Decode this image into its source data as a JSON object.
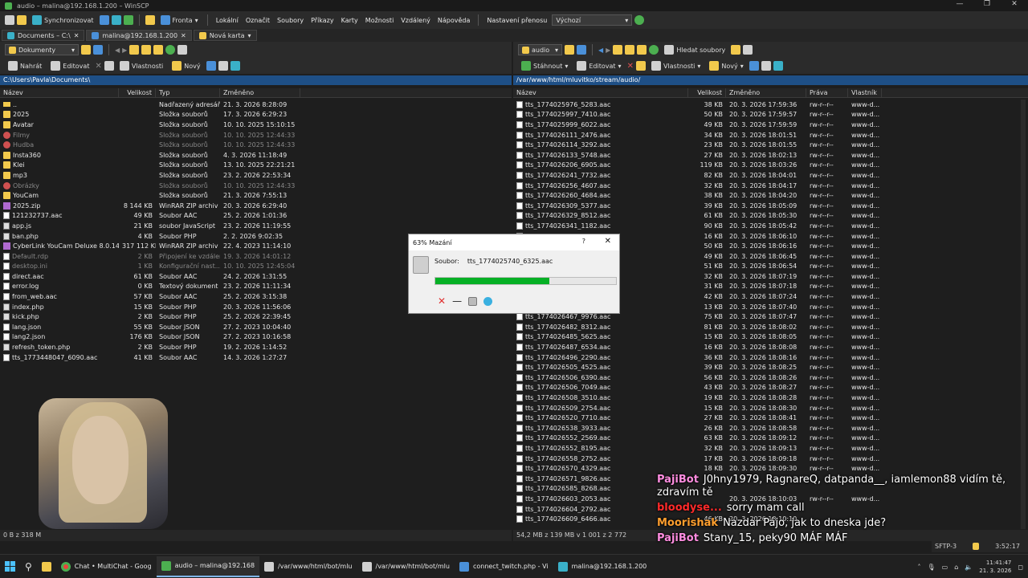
{
  "window": {
    "title": "audio – malina@192.168.1.200 – WinSCP",
    "controls": [
      "—",
      "❐",
      "✕"
    ]
  },
  "menubar": {
    "sync": "Synchronizovat",
    "queue": "Fronta",
    "menus": [
      "Lokální",
      "Označit",
      "Soubory",
      "Příkazy",
      "Karty",
      "Možnosti",
      "Vzdálený",
      "Nápověda"
    ],
    "transfer_label": "Nastavení přenosu",
    "transfer_value": "Výchozí"
  },
  "tabs": [
    {
      "label": "Documents – C:\\"
    },
    {
      "label": "malina@192.168.1.200"
    },
    {
      "label": "Nová karta"
    }
  ],
  "left": {
    "location": "Dokumenty",
    "actions": {
      "upload": "Nahrát",
      "edit": "Editovat",
      "props": "Vlastnosti",
      "new": "Nový"
    },
    "path": "C:\\Users\\Pavla\\Documents\\",
    "columns": {
      "name": "Název",
      "size": "Velikost",
      "type": "Typ",
      "changed": "Změněno"
    },
    "rows": [
      {
        "name": "..",
        "size": "",
        "type": "Nadřazený adresář",
        "changed": "21. 3. 2026 8:28:09",
        "icon": "up",
        "dim": false
      },
      {
        "name": "2025",
        "size": "",
        "type": "Složka souborů",
        "changed": "17. 3. 2026 6:29:23",
        "icon": "dir",
        "dim": false
      },
      {
        "name": "Avatar",
        "size": "",
        "type": "Složka souborů",
        "changed": "10. 10. 2025 15:10:15",
        "icon": "dir",
        "dim": false
      },
      {
        "name": "Filmy",
        "size": "",
        "type": "Složka souborů",
        "changed": "10. 10. 2025 12:44:33",
        "icon": "red",
        "dim": true
      },
      {
        "name": "Hudba",
        "size": "",
        "type": "Složka souborů",
        "changed": "10. 10. 2025 12:44:33",
        "icon": "red",
        "dim": true
      },
      {
        "name": "Insta360",
        "size": "",
        "type": "Složka souborů",
        "changed": "4. 3. 2026 11:18:49",
        "icon": "dir",
        "dim": false
      },
      {
        "name": "Klei",
        "size": "",
        "type": "Složka souborů",
        "changed": "13. 10. 2025 22:21:21",
        "icon": "dir",
        "dim": false
      },
      {
        "name": "mp3",
        "size": "",
        "type": "Složka souborů",
        "changed": "23. 2. 2026 22:53:34",
        "icon": "dir",
        "dim": false
      },
      {
        "name": "Obrázky",
        "size": "",
        "type": "Složka souborů",
        "changed": "10. 10. 2025 12:44:33",
        "icon": "red",
        "dim": true
      },
      {
        "name": "YouCam",
        "size": "",
        "type": "Složka souborů",
        "changed": "21. 3. 2026 7:55:13",
        "icon": "dir",
        "dim": false
      },
      {
        "name": "2025.zip",
        "size": "8 144 KB",
        "type": "WinRAR ZIP archiv",
        "changed": "20. 3. 2026 6:29:40",
        "icon": "zip",
        "dim": false
      },
      {
        "name": "121232737.aac",
        "size": "49 KB",
        "type": "Soubor AAC",
        "changed": "25. 2. 2026 1:01:36",
        "icon": "file",
        "dim": false
      },
      {
        "name": "app.js",
        "size": "21 KB",
        "type": "soubor JavaScript",
        "changed": "23. 2. 2026 11:19:55",
        "icon": "php",
        "dim": false
      },
      {
        "name": "ban.php",
        "size": "4 KB",
        "type": "Soubor PHP",
        "changed": "2. 2. 2026 9:02:35",
        "icon": "php",
        "dim": false
      },
      {
        "name": "CyberLink YouCam Deluxe 8.0.1411...",
        "size": "317 112 KB",
        "type": "WinRAR ZIP archiv",
        "changed": "22. 4. 2023 11:14:10",
        "icon": "zip",
        "dim": false
      },
      {
        "name": "Default.rdp",
        "size": "2 KB",
        "type": "Připojení ke vzdálené...",
        "changed": "19. 3. 2026 14:01:12",
        "icon": "file",
        "dim": true
      },
      {
        "name": "desktop.ini",
        "size": "1 KB",
        "type": "Konfigurační nast...",
        "changed": "10. 10. 2025 12:45:04",
        "icon": "file",
        "dim": true
      },
      {
        "name": "direct.aac",
        "size": "61 KB",
        "type": "Soubor AAC",
        "changed": "24. 2. 2026 1:31:55",
        "icon": "file",
        "dim": false
      },
      {
        "name": "error.log",
        "size": "0 KB",
        "type": "Textový dokument",
        "changed": "23. 2. 2026 11:11:34",
        "icon": "file",
        "dim": false
      },
      {
        "name": "from_web.aac",
        "size": "57 KB",
        "type": "Soubor AAC",
        "changed": "25. 2. 2026 3:15:38",
        "icon": "file",
        "dim": false
      },
      {
        "name": "index.php",
        "size": "15 KB",
        "type": "Soubor PHP",
        "changed": "20. 3. 2026 11:56:06",
        "icon": "php",
        "dim": false
      },
      {
        "name": "kick.php",
        "size": "2 KB",
        "type": "Soubor PHP",
        "changed": "25. 2. 2026 22:39:45",
        "icon": "php",
        "dim": false
      },
      {
        "name": "lang.json",
        "size": "55 KB",
        "type": "Soubor JSON",
        "changed": "27. 2. 2023 10:04:40",
        "icon": "file",
        "dim": false
      },
      {
        "name": "lang2.json",
        "size": "176 KB",
        "type": "Soubor JSON",
        "changed": "27. 2. 2023 10:16:58",
        "icon": "file",
        "dim": false
      },
      {
        "name": "refresh_token.php",
        "size": "2 KB",
        "type": "Soubor PHP",
        "changed": "19. 2. 2026 1:14:52",
        "icon": "php",
        "dim": false
      },
      {
        "name": "tts_1773448047_6090.aac",
        "size": "41 KB",
        "type": "Soubor AAC",
        "changed": "14. 3. 2026 1:27:27",
        "icon": "file",
        "dim": false
      }
    ],
    "status": "0 B z 318 M"
  },
  "right": {
    "location": "audio",
    "find": "Hledat soubory",
    "actions": {
      "download": "Stáhnout",
      "edit": "Editovat",
      "props": "Vlastnosti",
      "new": "Nový"
    },
    "path": "/var/www/html/mluvitko/stream/audio/",
    "columns": {
      "name": "Název",
      "size": "Velikost",
      "changed": "Změněno",
      "rights": "Práva",
      "owner": "Vlastník"
    },
    "rows": [
      {
        "name": "tts_1774025976_5283.aac",
        "size": "38 KB",
        "changed": "20. 3. 2026 17:59:36",
        "rights": "rw-r--r--",
        "owner": "www-d..."
      },
      {
        "name": "tts_1774025997_7410.aac",
        "size": "50 KB",
        "changed": "20. 3. 2026 17:59:57",
        "rights": "rw-r--r--",
        "owner": "www-d..."
      },
      {
        "name": "tts_1774025999_6022.aac",
        "size": "49 KB",
        "changed": "20. 3. 2026 17:59:59",
        "rights": "rw-r--r--",
        "owner": "www-d..."
      },
      {
        "name": "tts_1774026111_2476.aac",
        "size": "34 KB",
        "changed": "20. 3. 2026 18:01:51",
        "rights": "rw-r--r--",
        "owner": "www-d..."
      },
      {
        "name": "tts_1774026114_3292.aac",
        "size": "23 KB",
        "changed": "20. 3. 2026 18:01:55",
        "rights": "rw-r--r--",
        "owner": "www-d..."
      },
      {
        "name": "tts_1774026133_5748.aac",
        "size": "27 KB",
        "changed": "20. 3. 2026 18:02:13",
        "rights": "rw-r--r--",
        "owner": "www-d..."
      },
      {
        "name": "tts_1774026206_6905.aac",
        "size": "119 KB",
        "changed": "20. 3. 2026 18:03:26",
        "rights": "rw-r--r--",
        "owner": "www-d..."
      },
      {
        "name": "tts_1774026241_7732.aac",
        "size": "82 KB",
        "changed": "20. 3. 2026 18:04:01",
        "rights": "rw-r--r--",
        "owner": "www-d..."
      },
      {
        "name": "tts_1774026256_4607.aac",
        "size": "32 KB",
        "changed": "20. 3. 2026 18:04:17",
        "rights": "rw-r--r--",
        "owner": "www-d..."
      },
      {
        "name": "tts_1774026260_4684.aac",
        "size": "38 KB",
        "changed": "20. 3. 2026 18:04:20",
        "rights": "rw-r--r--",
        "owner": "www-d..."
      },
      {
        "name": "tts_1774026309_5377.aac",
        "size": "39 KB",
        "changed": "20. 3. 2026 18:05:09",
        "rights": "rw-r--r--",
        "owner": "www-d..."
      },
      {
        "name": "tts_1774026329_8512.aac",
        "size": "61 KB",
        "changed": "20. 3. 2026 18:05:30",
        "rights": "rw-r--r--",
        "owner": "www-d..."
      },
      {
        "name": "tts_1774026341_1182.aac",
        "size": "90 KB",
        "changed": "20. 3. 2026 18:05:42",
        "rights": "rw-r--r--",
        "owner": "www-d..."
      },
      {
        "name": "",
        "size": "16 KB",
        "changed": "20. 3. 2026 18:06:10",
        "rights": "rw-r--r--",
        "owner": "www-d..."
      },
      {
        "name": "",
        "size": "50 KB",
        "changed": "20. 3. 2026 18:06:16",
        "rights": "rw-r--r--",
        "owner": "www-d..."
      },
      {
        "name": "",
        "size": "49 KB",
        "changed": "20. 3. 2026 18:06:45",
        "rights": "rw-r--r--",
        "owner": "www-d..."
      },
      {
        "name": "",
        "size": "51 KB",
        "changed": "20. 3. 2026 18:06:54",
        "rights": "rw-r--r--",
        "owner": "www-d..."
      },
      {
        "name": "",
        "size": "32 KB",
        "changed": "20. 3. 2026 18:07:19",
        "rights": "rw-r--r--",
        "owner": "www-d..."
      },
      {
        "name": "",
        "size": "31 KB",
        "changed": "20. 3. 2026 18:07:18",
        "rights": "rw-r--r--",
        "owner": "www-d..."
      },
      {
        "name": "",
        "size": "42 KB",
        "changed": "20. 3. 2026 18:07:24",
        "rights": "rw-r--r--",
        "owner": "www-d..."
      },
      {
        "name": "",
        "size": "13 KB",
        "changed": "20. 3. 2026 18:07:40",
        "rights": "rw-r--r--",
        "owner": "www-d..."
      },
      {
        "name": "tts_1774026467_9976.aac",
        "size": "75 KB",
        "changed": "20. 3. 2026 18:07:47",
        "rights": "rw-r--r--",
        "owner": "www-d..."
      },
      {
        "name": "tts_1774026482_8312.aac",
        "size": "81 KB",
        "changed": "20. 3. 2026 18:08:02",
        "rights": "rw-r--r--",
        "owner": "www-d..."
      },
      {
        "name": "tts_1774026485_5625.aac",
        "size": "15 KB",
        "changed": "20. 3. 2026 18:08:05",
        "rights": "rw-r--r--",
        "owner": "www-d..."
      },
      {
        "name": "tts_1774026487_6534.aac",
        "size": "16 KB",
        "changed": "20. 3. 2026 18:08:08",
        "rights": "rw-r--r--",
        "owner": "www-d..."
      },
      {
        "name": "tts_1774026496_2290.aac",
        "size": "36 KB",
        "changed": "20. 3. 2026 18:08:16",
        "rights": "rw-r--r--",
        "owner": "www-d..."
      },
      {
        "name": "tts_1774026505_4525.aac",
        "size": "39 KB",
        "changed": "20. 3. 2026 18:08:25",
        "rights": "rw-r--r--",
        "owner": "www-d..."
      },
      {
        "name": "tts_1774026506_6390.aac",
        "size": "56 KB",
        "changed": "20. 3. 2026 18:08:26",
        "rights": "rw-r--r--",
        "owner": "www-d..."
      },
      {
        "name": "tts_1774026506_7049.aac",
        "size": "43 KB",
        "changed": "20. 3. 2026 18:08:27",
        "rights": "rw-r--r--",
        "owner": "www-d..."
      },
      {
        "name": "tts_1774026508_3510.aac",
        "size": "19 KB",
        "changed": "20. 3. 2026 18:08:28",
        "rights": "rw-r--r--",
        "owner": "www-d..."
      },
      {
        "name": "tts_1774026509_2754.aac",
        "size": "15 KB",
        "changed": "20. 3. 2026 18:08:30",
        "rights": "rw-r--r--",
        "owner": "www-d..."
      },
      {
        "name": "tts_1774026520_7710.aac",
        "size": "27 KB",
        "changed": "20. 3. 2026 18:08:41",
        "rights": "rw-r--r--",
        "owner": "www-d..."
      },
      {
        "name": "tts_1774026538_3933.aac",
        "size": "26 KB",
        "changed": "20. 3. 2026 18:08:58",
        "rights": "rw-r--r--",
        "owner": "www-d..."
      },
      {
        "name": "tts_1774026552_2569.aac",
        "size": "63 KB",
        "changed": "20. 3. 2026 18:09:12",
        "rights": "rw-r--r--",
        "owner": "www-d..."
      },
      {
        "name": "tts_1774026552_8195.aac",
        "size": "32 KB",
        "changed": "20. 3. 2026 18:09:13",
        "rights": "rw-r--r--",
        "owner": "www-d..."
      },
      {
        "name": "tts_1774026558_2752.aac",
        "size": "17 KB",
        "changed": "20. 3. 2026 18:09:18",
        "rights": "rw-r--r--",
        "owner": "www-d..."
      },
      {
        "name": "tts_1774026570_4329.aac",
        "size": "18 KB",
        "changed": "20. 3. 2026 18:09:30",
        "rights": "rw-r--r--",
        "owner": "www-d..."
      },
      {
        "name": "tts_1774026571_9826.aac",
        "size": "",
        "changed": "",
        "rights": "",
        "owner": ""
      },
      {
        "name": "tts_1774026585_8268.aac",
        "size": "",
        "changed": "",
        "rights": "",
        "owner": ""
      },
      {
        "name": "tts_1774026603_2053.aac",
        "size": "",
        "changed": "20. 3. 2026 18:10:03",
        "rights": "rw-r--r--",
        "owner": "www-d..."
      },
      {
        "name": "tts_1774026604_2792.aac",
        "size": "",
        "changed": "",
        "rights": "",
        "owner": ""
      },
      {
        "name": "tts_1774026609_6466.aac",
        "size": "46 KB",
        "changed": "20. 3. 2026 18:10:10",
        "rights": "",
        "owner": ""
      }
    ],
    "status": "54,2 MB z 139 MB v 1 001 z 2 772",
    "protocol": "SFTP-3",
    "elapsed": "3:52:17"
  },
  "dialog": {
    "title": "63% Mazání",
    "help": "?",
    "close": "✕",
    "file_label": "Soubor:",
    "file_value": "tts_1774025740_6325.aac",
    "progress_pct": 63
  },
  "chat": [
    {
      "user": "PajiBot",
      "color": "#ff8de0",
      "text": "J0hny1979, RagnareQ, datpanda__, iamlemon88 vidím tě, zdravím tě"
    },
    {
      "user": "bloodyse...",
      "color": "#ff2a2a",
      "text": "sorry mam call"
    },
    {
      "user": "Moorishak",
      "color": "#ff9f2e",
      "text": "Nazdar Pájo, jak to dneska jde?"
    },
    {
      "user": "PajiBot",
      "color": "#ff8de0",
      "text": "Stany_15, peky90 MÁF MÁF"
    }
  ],
  "taskbar": {
    "items": [
      {
        "label": "Chat • MultiChat - Goog",
        "icon": "chrome-icon"
      },
      {
        "label": "audio – malina@192.168",
        "icon": "winscp-icon"
      },
      {
        "label": "/var/www/html/bot/mlu",
        "icon": "notepad-icon"
      },
      {
        "label": "/var/www/html/bot/mlu",
        "icon": "notepad-icon"
      },
      {
        "label": "connect_twitch.php - Vi",
        "icon": "vscode-icon"
      },
      {
        "label": "malina@192.168.1.200",
        "icon": "putty-icon"
      }
    ],
    "time": "11:41:47",
    "date": "21. 3. 2026"
  }
}
